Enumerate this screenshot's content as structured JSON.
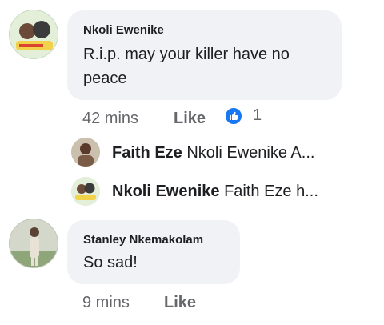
{
  "comments": [
    {
      "author": "Nkoli Ewenike",
      "text": "R.i.p. may your killer have no peace",
      "time": "42 mins",
      "like_label": "Like",
      "reaction_icon": "like-icon",
      "reaction_count": "1",
      "avatar_icon": "profile-photo",
      "replies": [
        {
          "author": "Faith Eze",
          "preview": "Nkoli Ewenike A...",
          "avatar_icon": "profile-photo"
        },
        {
          "author": "Nkoli Ewenike",
          "preview": "Faith Eze h...",
          "avatar_icon": "profile-photo"
        }
      ]
    },
    {
      "author": "Stanley Nkemakolam",
      "text": "So sad!",
      "time": "9 mins",
      "like_label": "Like",
      "avatar_icon": "profile-photo"
    }
  ],
  "colors": {
    "bubble": "#f0f2f5",
    "meta_text": "#65676b",
    "reaction_blue": "#1877f2"
  }
}
